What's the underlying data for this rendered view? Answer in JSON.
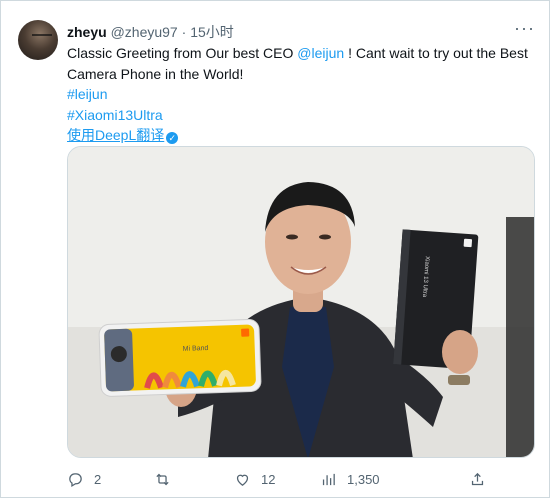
{
  "tweet": {
    "author_name": "zheyu",
    "author_handle": "@zheyu97",
    "separator": "·",
    "time": "15小时",
    "text_line1_before": "Classic Greeting from Our best CEO ",
    "mention": "@leijun",
    "text_line1_after": " ! Cant wait to try out the Best",
    "text_line2": "Camera Phone in the World!",
    "hashtag1": "#leijun",
    "hashtag2": "#Xiaomi13Ultra",
    "translate_label": "使用DeepL翻译"
  },
  "media": {
    "phone_screen_label": "Mi Band",
    "box_label": "Xiaomi 13 Ultra"
  },
  "actions": {
    "replies": "2",
    "retweets": "",
    "likes": "12",
    "views": "1,350"
  },
  "icons": [
    "avatar",
    "more-icon",
    "verified-icon",
    "reply-icon",
    "retweet-icon",
    "like-icon",
    "views-icon",
    "share-icon"
  ],
  "colors": {
    "accent": "#1d9bf0",
    "text": "#0f1419",
    "muted": "#536471",
    "border": "#cfd9de"
  }
}
